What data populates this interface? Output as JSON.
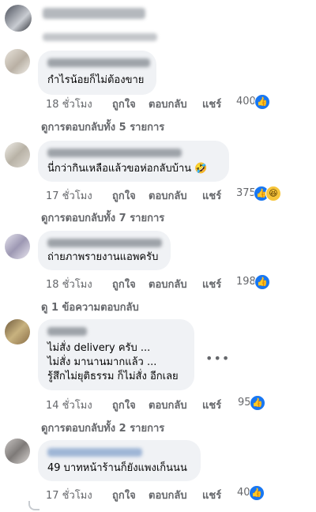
{
  "top": {},
  "comments": [
    {
      "text": [
        "กำไรน้อยก็ไม่ต้องขาย"
      ],
      "time": "18 ชั่วโมง",
      "like": "ถูกใจ",
      "reply": "ตอบกลับ",
      "share": "แชร์",
      "reactions": "400",
      "reaction_icons": [
        "like-icon"
      ],
      "replies_link": "ดูการตอบกลับทั้ง 5 รายการ"
    },
    {
      "text": [
        "นี่กว่ากินเหลือแล้วขอห่อกลับบ้าน 🤣"
      ],
      "time": "17 ชั่วโมง",
      "like": "ถูกใจ",
      "reply": "ตอบกลับ",
      "share": "แชร์",
      "reactions": "375",
      "reaction_icons": [
        "like-icon",
        "haha-icon"
      ],
      "replies_link": "ดูการตอบกลับทั้ง 7 รายการ"
    },
    {
      "text": [
        "ถ่ายภาพรายงานแอพครับ"
      ],
      "time": "18 ชั่วโมง",
      "like": "ถูกใจ",
      "reply": "ตอบกลับ",
      "share": "แชร์",
      "reactions": "198",
      "reaction_icons": [
        "like-icon"
      ],
      "replies_link": "ดู 1 ข้อความตอบกลับ"
    },
    {
      "text": [
        "ไม่สั่ง delivery ครับ ...",
        "ไม่สั่ง มานานมากแล้ว ...",
        "รู้สึกไม่ยุติธรรม ก็ไม่สั่ง อีกเลย"
      ],
      "time": "14 ชั่วโมง",
      "like": "ถูกใจ",
      "reply": "ตอบกลับ",
      "share": "แชร์",
      "reactions": "95",
      "reaction_icons": [
        "like-icon"
      ],
      "replies_link": "ดูการตอบกลับทั้ง 2 รายการ"
    },
    {
      "text": [
        "49 บาทหน้าร้านก็ยังแพงเก็นนน"
      ],
      "time": "17 ชั่วโมง",
      "like": "ถูกใจ",
      "reply": "ตอบกลับ",
      "share": "แชร์",
      "reactions": "40",
      "reaction_icons": [
        "like-icon"
      ]
    }
  ],
  "colors": {
    "like": "#1877f2",
    "haha": "#f7c53b",
    "bubble": "#f0f2f5",
    "meta_text": "#65676b"
  },
  "icons": {
    "like": "👍",
    "haha": "😆",
    "more": "•••"
  }
}
